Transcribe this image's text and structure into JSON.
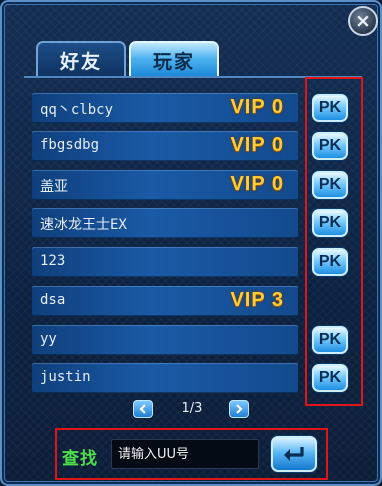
{
  "window": {
    "close_icon": "close-icon",
    "close_label": "×"
  },
  "tabs": [
    {
      "label": "好友",
      "active": false
    },
    {
      "label": "玩家",
      "active": true
    }
  ],
  "players": [
    {
      "name": "qq丶clbcy",
      "vip": "VIP 0",
      "pk": "PK"
    },
    {
      "name": "fbgsdbg",
      "vip": "VIP 0",
      "pk": "PK"
    },
    {
      "name": "盖亚",
      "vip": "VIP 0",
      "pk": "PK"
    },
    {
      "name": "速冰龙王士EX",
      "vip": "",
      "pk": "PK"
    },
    {
      "name": "123",
      "vip": "",
      "pk": "PK"
    },
    {
      "name": "dsa",
      "vip": "VIP 3",
      "pk": ""
    },
    {
      "name": "yy",
      "vip": "",
      "pk": "PK"
    },
    {
      "name": "justin",
      "vip": "",
      "pk": "PK"
    }
  ],
  "pager": {
    "prev_icon": "arrow-left-icon",
    "next_icon": "arrow-right-icon",
    "text": "1/3"
  },
  "search": {
    "label": "查找",
    "placeholder": "请输入UU号",
    "enter_icon": "enter-return-icon"
  },
  "colors": {
    "vip_gold": "#ffcc33",
    "search_label_green": "#4ee04a",
    "highlight_red": "#e01515"
  }
}
